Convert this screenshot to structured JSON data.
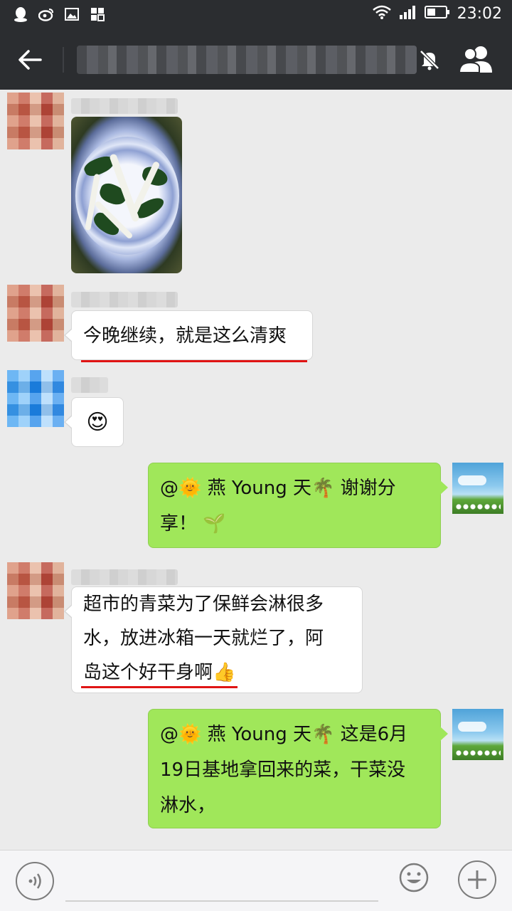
{
  "status_bar": {
    "time": "23:02",
    "left_icons": [
      "qq-icon",
      "weibo-icon",
      "image-icon",
      "apps-icon"
    ],
    "right_icons": [
      "wifi-icon",
      "signal-icon",
      "battery-icon"
    ]
  },
  "header": {
    "title": "",
    "icons": [
      "back-arrow-icon",
      "mute-bell-icon",
      "group-members-icon"
    ]
  },
  "messages": [
    {
      "side": "left",
      "type": "image",
      "avatar": "pixelated-red",
      "alt": ""
    },
    {
      "side": "left",
      "type": "text",
      "avatar": "pixelated-red",
      "text": "今晚继续，就是这么清爽",
      "underlined": true
    },
    {
      "side": "left",
      "type": "emoji",
      "avatar": "pixelated-blue",
      "emoji": "😍"
    },
    {
      "side": "right",
      "type": "text",
      "lines": [
        "@🌞 燕 Young 天🌴 谢谢分",
        "享！ 🌱"
      ]
    },
    {
      "side": "left",
      "type": "text",
      "avatar": "pixelated-red",
      "lines": [
        "超市的青菜为了保鲜会淋很多",
        "水，放进冰箱一天就烂了，阿",
        "岛这个好干身啊👍"
      ],
      "underlined_last_line": true
    },
    {
      "side": "right",
      "type": "text",
      "lines": [
        "@🌞 燕 Young 天🌴 这是6月",
        "19日基地拿回来的菜，干菜没",
        "淋水，"
      ]
    }
  ],
  "input_bar": {
    "placeholder": "",
    "icons": [
      "voice-icon",
      "emoji-icon",
      "plus-icon"
    ]
  },
  "colors": {
    "header_bg": "#2b2d30",
    "chat_bg": "#ebebeb",
    "bubble_self": "#a0e75a",
    "bubble_other": "#ffffff",
    "underline": "#e01414"
  }
}
